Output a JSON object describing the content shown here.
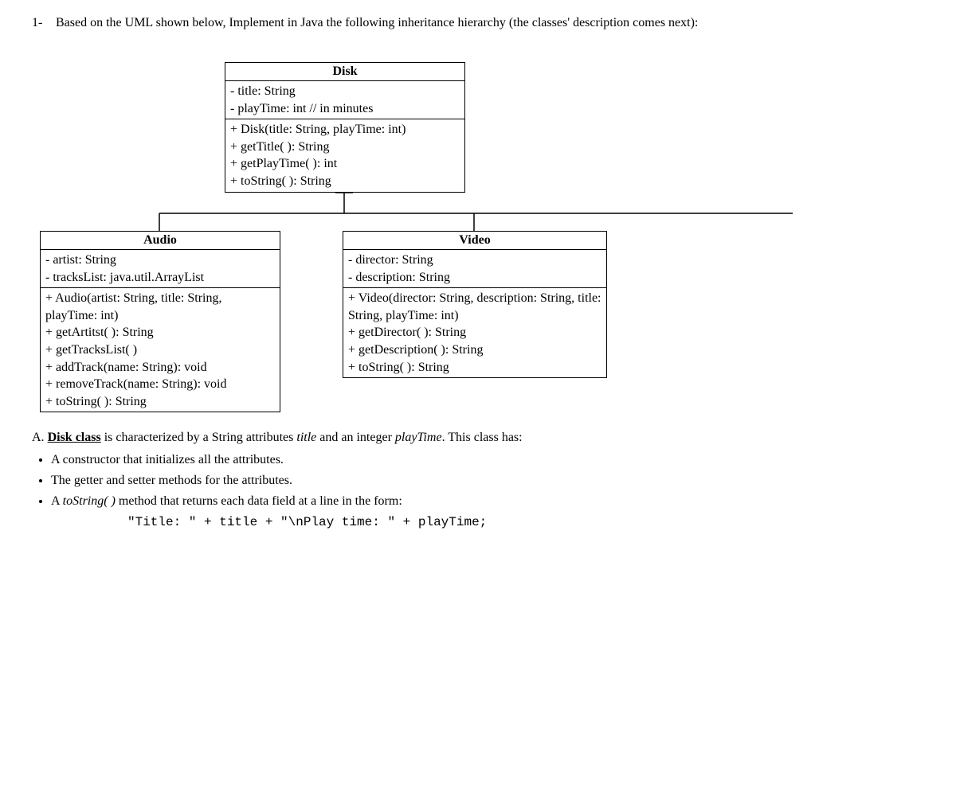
{
  "question": {
    "number": "1-",
    "text": "Based on the UML shown below, Implement in Java the following inheritance hierarchy (the classes' description comes next):"
  },
  "disk": {
    "name": "Disk",
    "attrs": [
      "- title: String",
      "- playTime: int // in minutes"
    ],
    "methods": [
      "+ Disk(title: String, playTime: int)",
      "+ getTitle( ): String",
      "+ getPlayTime( ): int",
      "+ toString( ): String"
    ]
  },
  "audio": {
    "name": "Audio",
    "attrs": [
      "- artist: String",
      "- tracksList: java.util.ArrayList"
    ],
    "methods": [
      "+ Audio(artist: String, title: String, playTime: int)",
      "+ getArtitst( ): String",
      "+ getTracksList( )",
      "+ addTrack(name: String): void",
      "+ removeTrack(name: String): void",
      "+ toString( ): String"
    ]
  },
  "video": {
    "name": "Video",
    "attrs": [
      "- director: String",
      "- description: String"
    ],
    "methods": [
      "+ Video(director: String, description: String, title: String, playTime: int)",
      "+ getDirector( ): String",
      "+ getDescription( ): String",
      "+ toString( ): String"
    ]
  },
  "description": {
    "heading_prefix": "A. ",
    "heading_class": "Disk class",
    "heading_rest": " is characterized by a String attributes ",
    "heading_title": "title",
    "heading_and": " and an integer ",
    "heading_playtime": "playTime",
    "heading_end": ". This class has:",
    "bullets": {
      "b1": "A constructor that initializes all the attributes.",
      "b2": "The getter and setter methods for the attributes.",
      "b3_prefix": "A ",
      "b3_method": "toString( )",
      "b3_rest": " method that returns each data field at a line in the form:"
    },
    "code": "\"Title: \" + title + \"\\nPlay time: \" + playTime;"
  }
}
